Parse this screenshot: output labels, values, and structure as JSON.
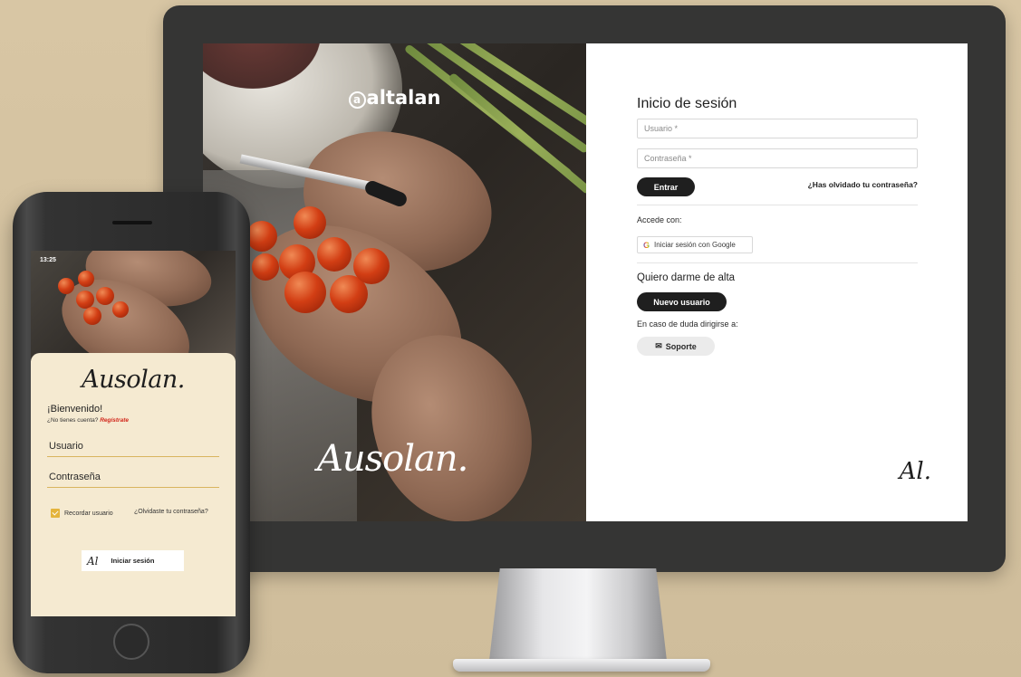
{
  "desktop": {
    "brand_top": "altalan",
    "brand_at": "a",
    "brand_bottom": "Ausolan.",
    "login": {
      "title": "Inicio de sesión",
      "user_placeholder": "Usuario *",
      "password_placeholder": "Contraseña *",
      "enter_label": "Entrar",
      "forgot_label": "¿Has olvidado tu contraseña?",
      "access_with": "Accede con:",
      "google_label": "Iniciar sesión con Google",
      "google_icon": "G",
      "signup_title": "Quiero darme de alta",
      "new_user_label": "Nuevo usuario",
      "doubt_text": "En caso de duda dirigirse a:",
      "support_label": "Soporte",
      "support_icon": "✉",
      "monogram": "Al."
    }
  },
  "mobile": {
    "time": "13:25",
    "logo": "Ausolan.",
    "welcome": "¡Bienvenido!",
    "no_account": "¿No tienes cuenta?",
    "register": "Regístrate",
    "user_label": "Usuario",
    "password_label": "Contraseña",
    "remember_label": "Recordar usuario",
    "forgot_label": "¿Olvidaste tu contraseña?",
    "login_mono": "Al",
    "login_label": "Iniciar sesión"
  },
  "colors": {
    "background": "#d8c6a4",
    "monitor_frame": "#353534",
    "dark_button": "#1f1f1f",
    "phone_sheet": "#f5ead1",
    "accent_gold": "#e4b43c",
    "register_red": "#d2261a"
  }
}
